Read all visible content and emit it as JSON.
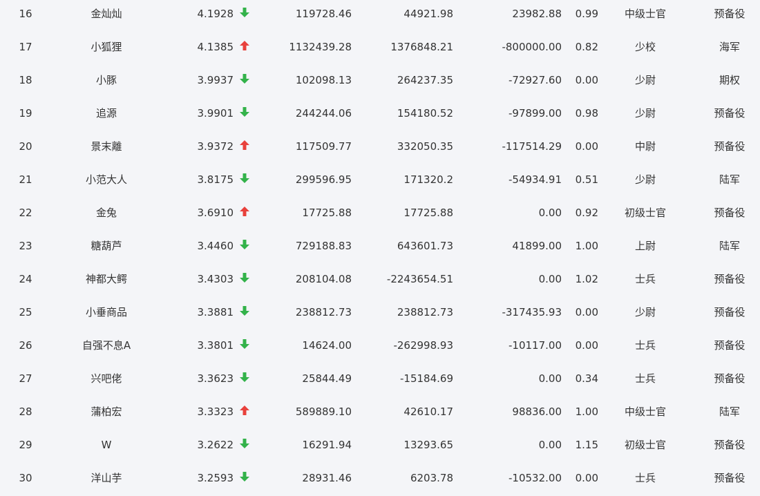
{
  "colors": {
    "background": "#f4f5f8",
    "text": "#333333",
    "up_arrow": "#e8413c",
    "down_arrow": "#33b24a"
  },
  "icons": {
    "up": "arrow-up-icon",
    "down": "arrow-down-icon"
  },
  "rows": [
    {
      "rank": "16",
      "name": "金灿灿",
      "score": "4.1928",
      "trend": "down",
      "v1": "119728.46",
      "v2": "44921.98",
      "v3": "23982.88",
      "ratio": "0.99",
      "title": "中级士官",
      "branch": "预备役"
    },
    {
      "rank": "17",
      "name": "小狐狸",
      "score": "4.1385",
      "trend": "up",
      "v1": "1132439.28",
      "v2": "1376848.21",
      "v3": "-800000.00",
      "ratio": "0.82",
      "title": "少校",
      "branch": "海军"
    },
    {
      "rank": "18",
      "name": "小豚",
      "score": "3.9937",
      "trend": "down",
      "v1": "102098.13",
      "v2": "264237.35",
      "v3": "-72927.60",
      "ratio": "0.00",
      "title": "少尉",
      "branch": "期权"
    },
    {
      "rank": "19",
      "name": "追源",
      "score": "3.9901",
      "trend": "down",
      "v1": "244244.06",
      "v2": "154180.52",
      "v3": "-97899.00",
      "ratio": "0.98",
      "title": "少尉",
      "branch": "预备役"
    },
    {
      "rank": "20",
      "name": "景末離",
      "score": "3.9372",
      "trend": "up",
      "v1": "117509.77",
      "v2": "332050.35",
      "v3": "-117514.29",
      "ratio": "0.00",
      "title": "中尉",
      "branch": "预备役"
    },
    {
      "rank": "21",
      "name": "小范大人",
      "score": "3.8175",
      "trend": "down",
      "v1": "299596.95",
      "v2": "171320.2",
      "v3": "-54934.91",
      "ratio": "0.51",
      "title": "少尉",
      "branch": "陆军"
    },
    {
      "rank": "22",
      "name": "金兔",
      "score": "3.6910",
      "trend": "up",
      "v1": "17725.88",
      "v2": "17725.88",
      "v3": "0.00",
      "ratio": "0.92",
      "title": "初级士官",
      "branch": "预备役"
    },
    {
      "rank": "23",
      "name": "糖葫芦",
      "score": "3.4460",
      "trend": "down",
      "v1": "729188.83",
      "v2": "643601.73",
      "v3": "41899.00",
      "ratio": "1.00",
      "title": "上尉",
      "branch": "陆军"
    },
    {
      "rank": "24",
      "name": "神都大鳄",
      "score": "3.4303",
      "trend": "down",
      "v1": "208104.08",
      "v2": "-2243654.51",
      "v3": "0.00",
      "ratio": "1.02",
      "title": "士兵",
      "branch": "预备役"
    },
    {
      "rank": "25",
      "name": "小垂商品",
      "score": "3.3881",
      "trend": "down",
      "v1": "238812.73",
      "v2": "238812.73",
      "v3": "-317435.93",
      "ratio": "0.00",
      "title": "少尉",
      "branch": "预备役"
    },
    {
      "rank": "26",
      "name": "自强不息A",
      "score": "3.3801",
      "trend": "down",
      "v1": "14624.00",
      "v2": "-262998.93",
      "v3": "-10117.00",
      "ratio": "0.00",
      "title": "士兵",
      "branch": "预备役"
    },
    {
      "rank": "27",
      "name": "兴吧佬",
      "score": "3.3623",
      "trend": "down",
      "v1": "25844.49",
      "v2": "-15184.69",
      "v3": "0.00",
      "ratio": "0.34",
      "title": "士兵",
      "branch": "预备役"
    },
    {
      "rank": "28",
      "name": "蒲柏宏",
      "score": "3.3323",
      "trend": "up",
      "v1": "589889.10",
      "v2": "42610.17",
      "v3": "98836.00",
      "ratio": "1.00",
      "title": "中级士官",
      "branch": "陆军"
    },
    {
      "rank": "29",
      "name": "W",
      "score": "3.2622",
      "trend": "down",
      "v1": "16291.94",
      "v2": "13293.65",
      "v3": "0.00",
      "ratio": "1.15",
      "title": "初级士官",
      "branch": "预备役"
    },
    {
      "rank": "30",
      "name": "洋山芋",
      "score": "3.2593",
      "trend": "down",
      "v1": "28931.46",
      "v2": "6203.78",
      "v3": "-10532.00",
      "ratio": "0.00",
      "title": "士兵",
      "branch": "预备役"
    }
  ]
}
